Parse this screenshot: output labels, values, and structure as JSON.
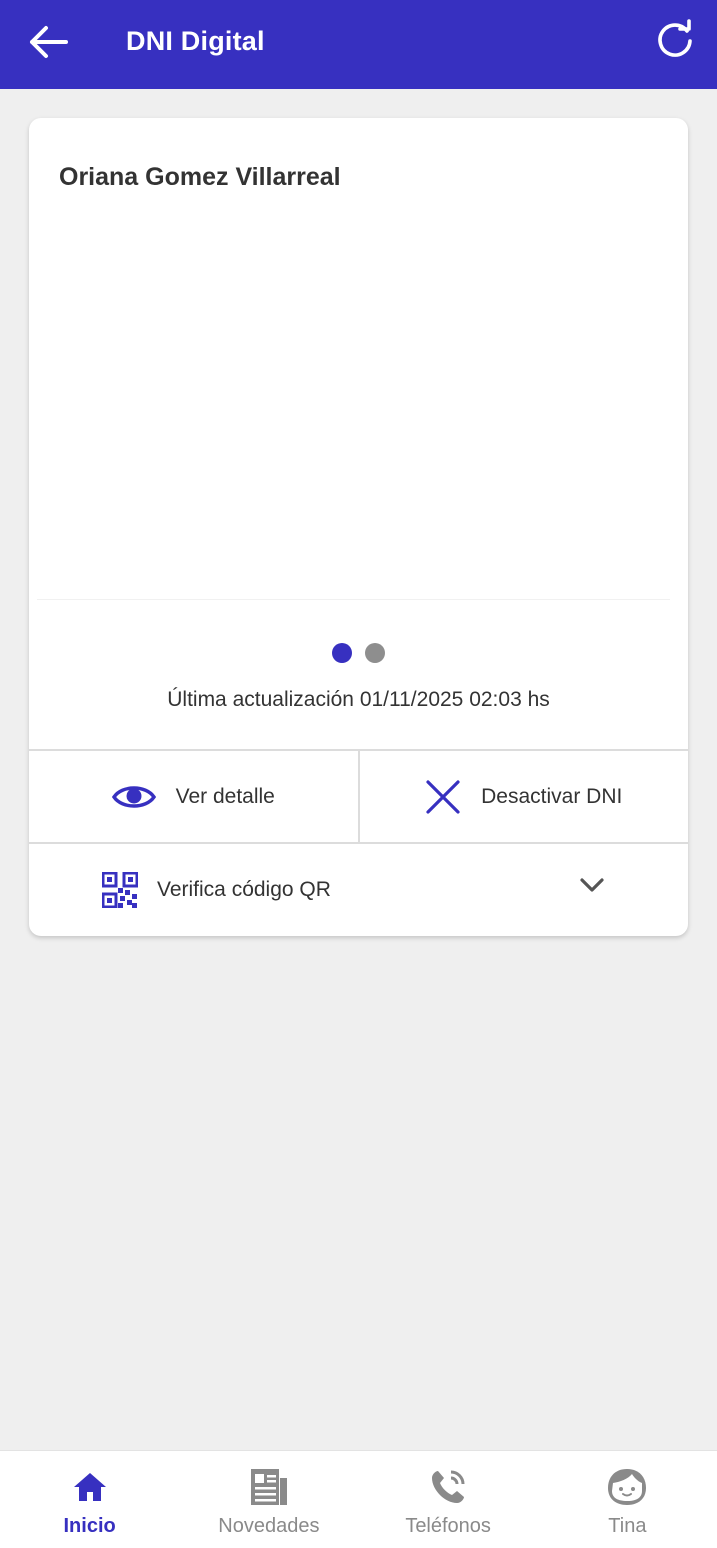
{
  "header": {
    "title": "DNI Digital",
    "back_icon": "arrow-left-icon",
    "refresh_icon": "refresh-icon"
  },
  "colors": {
    "primary": "#3730c0",
    "background": "#efefef",
    "inactive": "#8a8a8a"
  },
  "card": {
    "holder_name": "Oriana Gomez Villarreal",
    "carousel": {
      "pages": 2,
      "current": 1
    },
    "last_update": "Última actualización 01/11/2025 02:03 hs",
    "actions": [
      {
        "label": "Ver detalle",
        "icon": "eye-icon"
      },
      {
        "label": "Desactivar DNI",
        "icon": "close-icon"
      }
    ],
    "qr": {
      "label": "Verifica código QR",
      "icon": "qr-code-icon",
      "expand_icon": "chevron-down-icon"
    }
  },
  "bottom_nav": [
    {
      "label": "Inicio",
      "icon": "home-icon",
      "active": true
    },
    {
      "label": "Novedades",
      "icon": "newspaper-icon",
      "active": false
    },
    {
      "label": "Teléfonos",
      "icon": "phone-icon",
      "active": false
    },
    {
      "label": "Tina",
      "icon": "face-icon",
      "active": false
    }
  ]
}
